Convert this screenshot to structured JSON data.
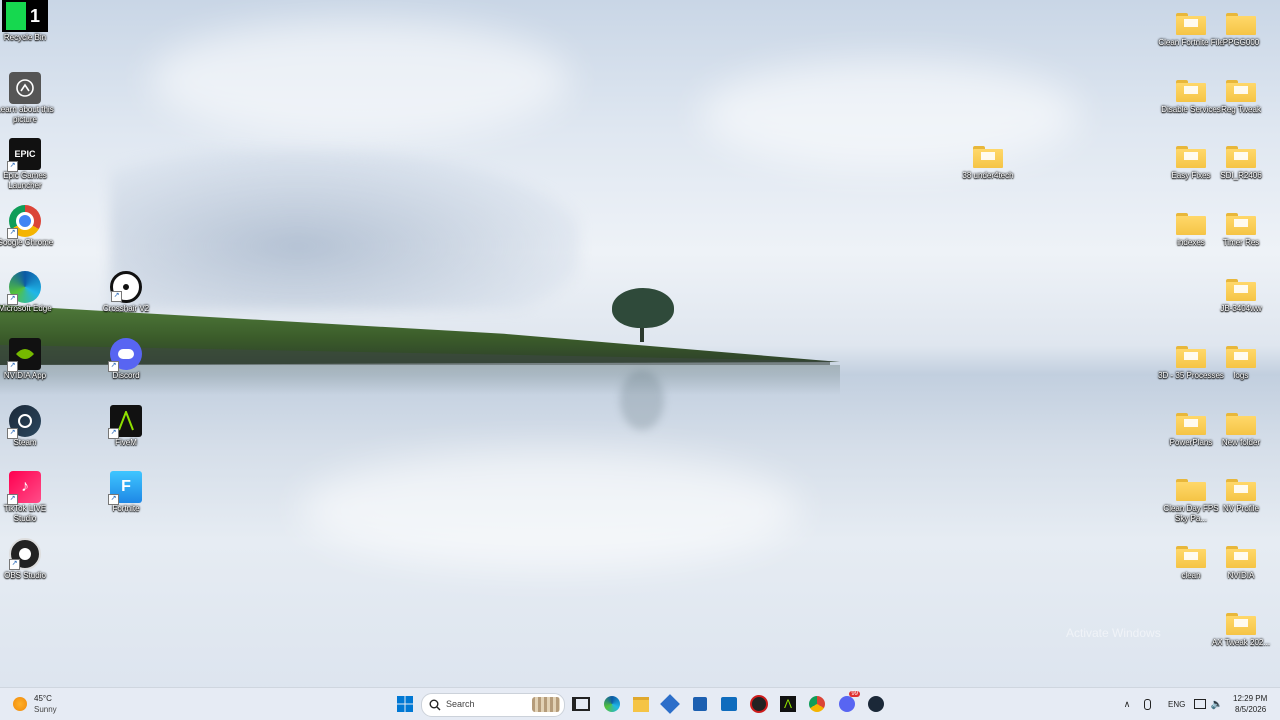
{
  "desktop": {
    "left_icons": [
      {
        "label": "Recycle Bin",
        "icon": "k1-icon"
      },
      {
        "label": "Learn about this picture",
        "icon": "learn-icon"
      },
      {
        "label": "Epic Games Launcher",
        "icon": "epic-icon",
        "badge": "EPIC"
      },
      {
        "label": "Google Chrome",
        "icon": "chrome-icon"
      },
      {
        "label": "Microsoft Edge",
        "icon": "edge-icon"
      },
      {
        "label": "NVIDIA App",
        "icon": "nvidia-icon"
      },
      {
        "label": "Steam",
        "icon": "steam-icon"
      },
      {
        "label": "TikTok LIVE Studio",
        "icon": "tiktok-icon"
      },
      {
        "label": "OBS Studio",
        "icon": "obs-icon"
      }
    ],
    "k1_badge": "1",
    "second_col_icons": [
      {
        "label": "Crosshair V2",
        "icon": "crosshair-icon"
      },
      {
        "label": "Discord",
        "icon": "discord-icon"
      },
      {
        "label": "FiveM",
        "icon": "fivem-icon"
      },
      {
        "label": "Fortnite",
        "icon": "fortnite-icon",
        "badge": "F"
      }
    ],
    "mid_folder": {
      "label": "38 under4tech"
    },
    "right_folders_col1": [
      {
        "label": "Clean Fortnite File"
      },
      {
        "label": "Disable Services"
      },
      {
        "label": "Easy Fixes"
      },
      {
        "label": "indexes"
      },
      {
        "label": "3D - 35 Processes"
      },
      {
        "label": "PowerPlans"
      },
      {
        "label": "Clean Day FPS Sky Pa..."
      },
      {
        "label": "clean"
      }
    ],
    "right_folders_col2": [
      {
        "label": "PPGG000"
      },
      {
        "label": "Reg Tweak"
      },
      {
        "label": "SDI_R2406"
      },
      {
        "label": "Timer Res"
      },
      {
        "label": "JB-3404ww"
      },
      {
        "label": "logs"
      },
      {
        "label": "New folder"
      },
      {
        "label": "NV Profile"
      },
      {
        "label": "NVIDIA"
      },
      {
        "label": "AX Tweak 202..."
      }
    ],
    "watermark": "Activate Windows"
  },
  "taskbar": {
    "weather_temp": "45°C",
    "weather_desc": "Sunny",
    "search_placeholder": "Search",
    "apps": [
      "start-icon",
      "search-icon",
      "widgets-icon",
      "task-view-icon",
      "edge-icon",
      "file-explorer-icon",
      "browser-icon",
      "store-icon",
      "outlook-icon",
      "media-icon",
      "fivem-icon",
      "chrome-icon",
      "discord-icon",
      "steam-icon"
    ],
    "discord_badge": "99",
    "language": "ENG",
    "time": "12:29 PM",
    "date": "8/5/2026"
  },
  "colors": {
    "folder": "#f5c445",
    "taskbar": "#e6ecf4",
    "accent": "#0078d4"
  }
}
